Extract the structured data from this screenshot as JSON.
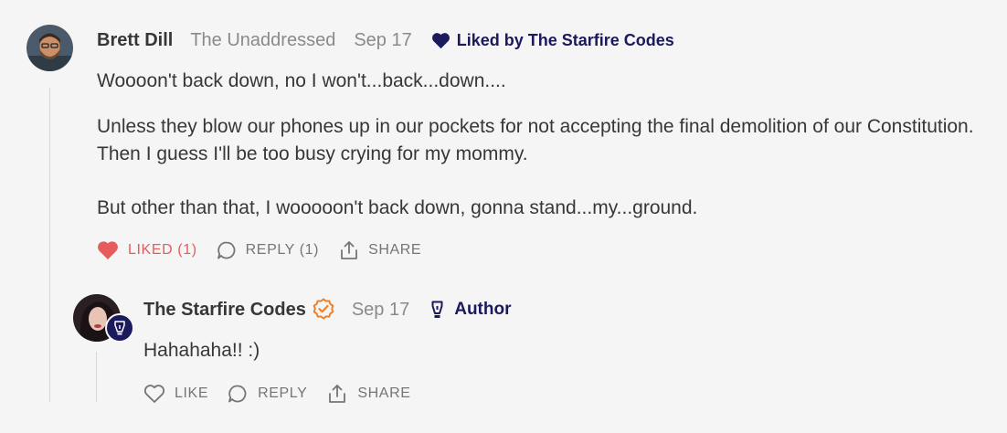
{
  "comment": {
    "author": "Brett Dill",
    "publication": "The Unaddressed",
    "date": "Sep 17",
    "liked_by": "Liked by The Starfire Codes",
    "paragraphs": [
      "Woooon't back down, no I won't...back...down....",
      "Unless they blow our phones up in our pockets for not accepting the final demolition of our Constitution. Then I guess I'll be too busy crying for my mommy.",
      "But other than that, I wooooon't back down, gonna stand...my...ground."
    ],
    "actions": {
      "like_label": "LIKED (1)",
      "reply_label": "REPLY (1)",
      "share_label": "SHARE"
    },
    "colors": {
      "liked": "#e65c5c"
    }
  },
  "reply": {
    "author": "The Starfire Codes",
    "date": "Sep 17",
    "tag": "Author",
    "paragraphs": [
      "Hahahaha!! :)"
    ],
    "actions": {
      "like_label": "LIKE",
      "reply_label": "REPLY",
      "share_label": "SHARE"
    },
    "colors": {
      "verified": "#f07d23",
      "author_tag": "#1a1a5c"
    }
  },
  "icons": {
    "heart_filled": "heart-filled-icon",
    "heart_outline": "heart-outline-icon",
    "reply": "speech-bubble-icon",
    "share": "share-icon",
    "verified": "verified-check-icon",
    "author": "pen-nib-icon"
  }
}
